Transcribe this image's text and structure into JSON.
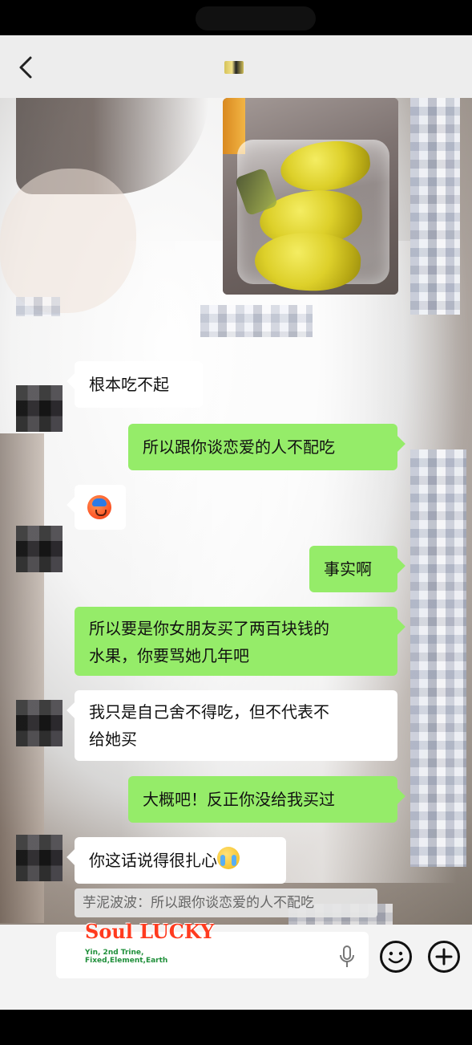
{
  "header": {
    "back_icon": "chevron-left-icon"
  },
  "messages": [
    {
      "side": "left",
      "text": "根本吃不起"
    },
    {
      "side": "right",
      "text": "所以跟你谈恋爱的人不配吃"
    },
    {
      "side": "left",
      "emoji": "flushed-sweat-emoji"
    },
    {
      "side": "right",
      "text": "事实啊"
    },
    {
      "side": "right",
      "text_line1": "所以要是你女朋友买了两百块钱的",
      "text_line2": "水果，你要骂她几年吧"
    },
    {
      "side": "left",
      "text_line1": "我只是自己舍不得吃，但不代表不",
      "text_line2": "给她买"
    },
    {
      "side": "right",
      "text": "大概吧！反正你没给我买过"
    },
    {
      "side": "left",
      "text": "你这话说得很扎心",
      "emoji": "crying-face-emoji"
    }
  ],
  "quote": {
    "text": "芋泥波波：所以跟你谈恋爱的人不配吃"
  },
  "input": {
    "watermark_title": "Soul LUCKY",
    "watermark_sub_line1": "Yin, 2nd Trine,",
    "watermark_sub_line2": "Fixed,Element,Earth",
    "mic_icon": "mic-icon",
    "emoji_icon": "emoji-icon",
    "plus_icon": "plus-icon"
  },
  "colors": {
    "sent_bubble": "#95ec69",
    "received_bubble": "#ffffff",
    "header_bg": "#ededed",
    "input_bg": "#f3f3f3"
  }
}
